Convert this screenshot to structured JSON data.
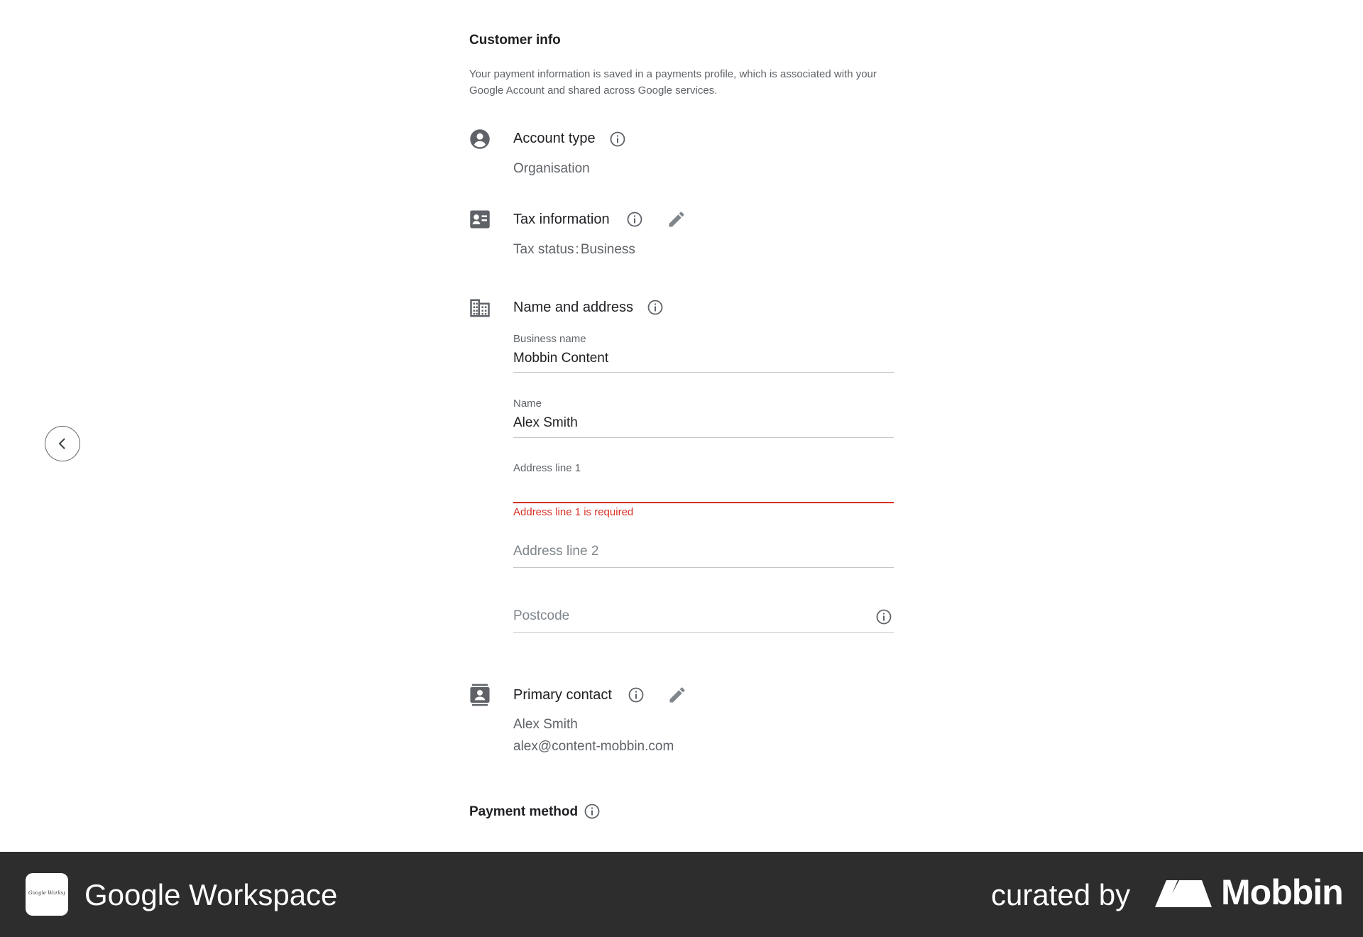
{
  "header": {
    "title": "Customer info",
    "intro": "Your payment information is saved in a payments profile, which is associated with your Google Account and shared across Google services."
  },
  "account_type": {
    "icon": "account-circle-icon",
    "title": "Account type",
    "value": "Organisation"
  },
  "tax_info": {
    "icon": "id-card-icon",
    "title": "Tax information",
    "label": "Tax status",
    "separator": ":",
    "value": "Business"
  },
  "name_address": {
    "icon": "building-icon",
    "title": "Name and address",
    "business_name": {
      "label": "Business name",
      "value": "Mobbin Content"
    },
    "name": {
      "label": "Name",
      "value": "Alex Smith"
    },
    "address1": {
      "label": "Address line 1",
      "value": "",
      "error": "Address line 1 is required"
    },
    "address2": {
      "placeholder": "Address line 2"
    },
    "postcode": {
      "placeholder": "Postcode"
    }
  },
  "primary_contact": {
    "icon": "contact-card-icon",
    "title": "Primary contact",
    "name": "Alex Smith",
    "email": "alex@content-mobbin.com"
  },
  "payment_method": {
    "title": "Payment method"
  },
  "footer": {
    "app_name": "Google Workspace",
    "curated_by": "curated by",
    "brand": "Mobbin",
    "logo_text": "Google Workspace"
  },
  "colors": {
    "error": "#d93025",
    "text_primary": "#202124",
    "text_secondary": "#5f6368",
    "footer_bg": "#2d2d2d"
  }
}
